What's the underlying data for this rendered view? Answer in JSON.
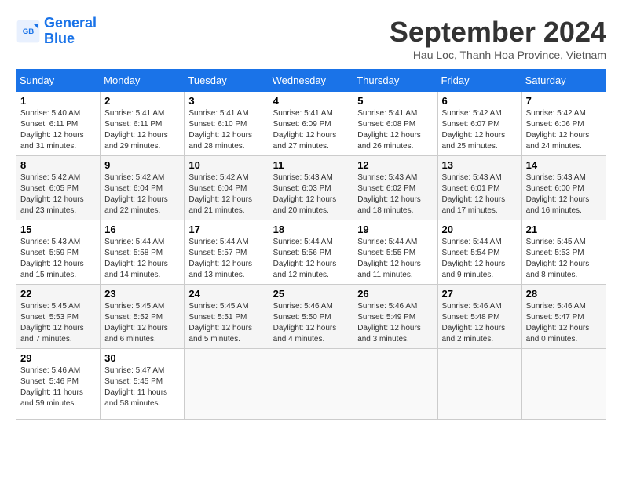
{
  "header": {
    "logo_line1": "General",
    "logo_line2": "Blue",
    "month": "September 2024",
    "location": "Hau Loc, Thanh Hoa Province, Vietnam"
  },
  "days_of_week": [
    "Sunday",
    "Monday",
    "Tuesday",
    "Wednesday",
    "Thursday",
    "Friday",
    "Saturday"
  ],
  "weeks": [
    [
      {
        "day": "1",
        "sunrise": "5:40 AM",
        "sunset": "6:11 PM",
        "daylight": "12 hours and 31 minutes."
      },
      {
        "day": "2",
        "sunrise": "5:41 AM",
        "sunset": "6:11 PM",
        "daylight": "12 hours and 29 minutes."
      },
      {
        "day": "3",
        "sunrise": "5:41 AM",
        "sunset": "6:10 PM",
        "daylight": "12 hours and 28 minutes."
      },
      {
        "day": "4",
        "sunrise": "5:41 AM",
        "sunset": "6:09 PM",
        "daylight": "12 hours and 27 minutes."
      },
      {
        "day": "5",
        "sunrise": "5:41 AM",
        "sunset": "6:08 PM",
        "daylight": "12 hours and 26 minutes."
      },
      {
        "day": "6",
        "sunrise": "5:42 AM",
        "sunset": "6:07 PM",
        "daylight": "12 hours and 25 minutes."
      },
      {
        "day": "7",
        "sunrise": "5:42 AM",
        "sunset": "6:06 PM",
        "daylight": "12 hours and 24 minutes."
      }
    ],
    [
      {
        "day": "8",
        "sunrise": "5:42 AM",
        "sunset": "6:05 PM",
        "daylight": "12 hours and 23 minutes."
      },
      {
        "day": "9",
        "sunrise": "5:42 AM",
        "sunset": "6:04 PM",
        "daylight": "12 hours and 22 minutes."
      },
      {
        "day": "10",
        "sunrise": "5:42 AM",
        "sunset": "6:04 PM",
        "daylight": "12 hours and 21 minutes."
      },
      {
        "day": "11",
        "sunrise": "5:43 AM",
        "sunset": "6:03 PM",
        "daylight": "12 hours and 20 minutes."
      },
      {
        "day": "12",
        "sunrise": "5:43 AM",
        "sunset": "6:02 PM",
        "daylight": "12 hours and 18 minutes."
      },
      {
        "day": "13",
        "sunrise": "5:43 AM",
        "sunset": "6:01 PM",
        "daylight": "12 hours and 17 minutes."
      },
      {
        "day": "14",
        "sunrise": "5:43 AM",
        "sunset": "6:00 PM",
        "daylight": "12 hours and 16 minutes."
      }
    ],
    [
      {
        "day": "15",
        "sunrise": "5:43 AM",
        "sunset": "5:59 PM",
        "daylight": "12 hours and 15 minutes."
      },
      {
        "day": "16",
        "sunrise": "5:44 AM",
        "sunset": "5:58 PM",
        "daylight": "12 hours and 14 minutes."
      },
      {
        "day": "17",
        "sunrise": "5:44 AM",
        "sunset": "5:57 PM",
        "daylight": "12 hours and 13 minutes."
      },
      {
        "day": "18",
        "sunrise": "5:44 AM",
        "sunset": "5:56 PM",
        "daylight": "12 hours and 12 minutes."
      },
      {
        "day": "19",
        "sunrise": "5:44 AM",
        "sunset": "5:55 PM",
        "daylight": "12 hours and 11 minutes."
      },
      {
        "day": "20",
        "sunrise": "5:44 AM",
        "sunset": "5:54 PM",
        "daylight": "12 hours and 9 minutes."
      },
      {
        "day": "21",
        "sunrise": "5:45 AM",
        "sunset": "5:53 PM",
        "daylight": "12 hours and 8 minutes."
      }
    ],
    [
      {
        "day": "22",
        "sunrise": "5:45 AM",
        "sunset": "5:53 PM",
        "daylight": "12 hours and 7 minutes."
      },
      {
        "day": "23",
        "sunrise": "5:45 AM",
        "sunset": "5:52 PM",
        "daylight": "12 hours and 6 minutes."
      },
      {
        "day": "24",
        "sunrise": "5:45 AM",
        "sunset": "5:51 PM",
        "daylight": "12 hours and 5 minutes."
      },
      {
        "day": "25",
        "sunrise": "5:46 AM",
        "sunset": "5:50 PM",
        "daylight": "12 hours and 4 minutes."
      },
      {
        "day": "26",
        "sunrise": "5:46 AM",
        "sunset": "5:49 PM",
        "daylight": "12 hours and 3 minutes."
      },
      {
        "day": "27",
        "sunrise": "5:46 AM",
        "sunset": "5:48 PM",
        "daylight": "12 hours and 2 minutes."
      },
      {
        "day": "28",
        "sunrise": "5:46 AM",
        "sunset": "5:47 PM",
        "daylight": "12 hours and 0 minutes."
      }
    ],
    [
      {
        "day": "29",
        "sunrise": "5:46 AM",
        "sunset": "5:46 PM",
        "daylight": "11 hours and 59 minutes."
      },
      {
        "day": "30",
        "sunrise": "5:47 AM",
        "sunset": "5:45 PM",
        "daylight": "11 hours and 58 minutes."
      },
      null,
      null,
      null,
      null,
      null
    ]
  ]
}
